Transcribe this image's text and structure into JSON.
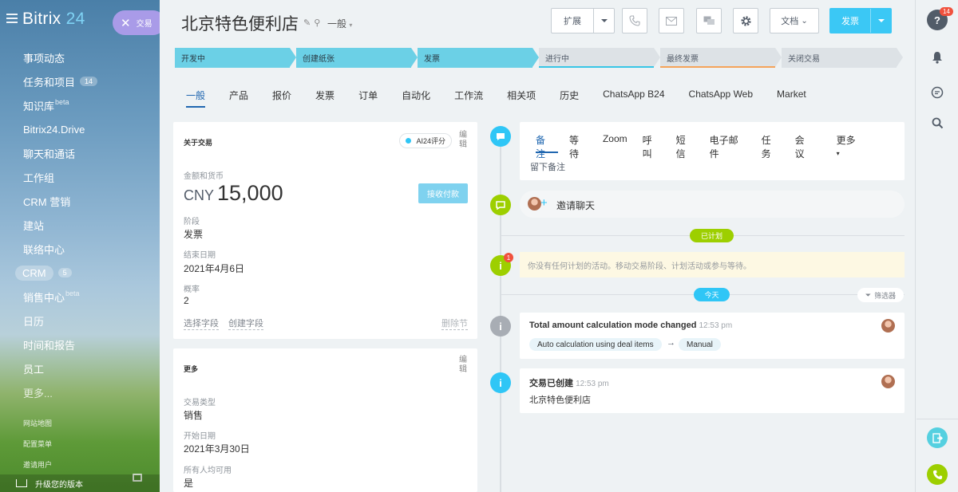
{
  "sidebar": {
    "logo_main": "Bitrix",
    "logo_num": "24",
    "deal_pill": "交易",
    "items": [
      {
        "label": "事项动态",
        "sup": "",
        "badge": ""
      },
      {
        "label": "任务和项目",
        "sup": "",
        "badge": "14"
      },
      {
        "label": "知识库",
        "sup": "beta",
        "badge": ""
      },
      {
        "label": "Bitrix24.Drive",
        "sup": "",
        "badge": ""
      },
      {
        "label": "聊天和通话",
        "sup": "",
        "badge": ""
      },
      {
        "label": "工作组",
        "sup": "",
        "badge": ""
      },
      {
        "label": "CRM 营销",
        "sup": "",
        "badge": ""
      },
      {
        "label": "建站",
        "sup": "",
        "badge": ""
      },
      {
        "label": "联络中心",
        "sup": "",
        "badge": ""
      },
      {
        "label": "CRM",
        "sup": "",
        "badge": "5"
      },
      {
        "label": "销售中心",
        "sup": "beta",
        "badge": ""
      },
      {
        "label": "日历",
        "sup": "",
        "badge": ""
      },
      {
        "label": "时间和报告",
        "sup": "",
        "badge": ""
      },
      {
        "label": "员工",
        "sup": "",
        "badge": ""
      },
      {
        "label": "更多...",
        "sup": "",
        "badge": ""
      }
    ],
    "sitemap": "网站地图",
    "config_menu": "配置菜单",
    "invite": "邀请用户",
    "upgrade": "升级您的版本"
  },
  "header": {
    "title": "北京特色便利店",
    "category": "一般",
    "expand_label": "扩展",
    "docs_label": "文档",
    "invoice_label": "发票"
  },
  "stages": [
    {
      "label": "开发中",
      "state": "done"
    },
    {
      "label": "创建纸张",
      "state": "done"
    },
    {
      "label": "发票",
      "state": "done"
    },
    {
      "label": "进行中",
      "state": "todo"
    },
    {
      "label": "最终发票",
      "state": "todo"
    },
    {
      "label": "关闭交易",
      "state": "todo"
    }
  ],
  "tabs": [
    "一般",
    "产品",
    "报价",
    "发票",
    "订单",
    "自动化",
    "工作流",
    "相关项",
    "历史",
    "ChatsApp B24",
    "ChatsApp Web",
    "Market"
  ],
  "about": {
    "heading": "关于交易",
    "ai_label": "AI24评分",
    "edit_label": "编辑",
    "amount_label": "金额和货币",
    "currency": "CNY",
    "amount": "15,000",
    "pay_label": "接收付款",
    "stage_label": "阶段",
    "stage_value": "发票",
    "close_label": "结束日期",
    "close_value": "2021年4月6日",
    "prob_label": "概率",
    "prob_value": "2",
    "select_field": "选择字段",
    "create_field": "创建字段",
    "delete_section": "删除节"
  },
  "more": {
    "heading": "更多",
    "edit_label": "编辑",
    "type_label": "交易类型",
    "type_value": "销售",
    "start_label": "开始日期",
    "start_value": "2021年3月30日",
    "avail_label": "所有人均可用",
    "avail_value": "是"
  },
  "timeline": {
    "tabs": [
      "备注",
      "等待",
      "Zoom",
      "呼叫",
      "短信",
      "电子邮件",
      "任务",
      "会议",
      "更多"
    ],
    "note_placeholder": "留下备注",
    "invite_chat": "邀请聊天",
    "planned_label": "已计划",
    "empty_text": "你没有任何计划的活动。移动交易阶段、计划活动或参与等待。",
    "empty_badge": "1",
    "today_label": "今天",
    "filter_label": "筛选器",
    "event1": {
      "title": "Total amount calculation mode changed",
      "time": "12:53 pm",
      "from": "Auto calculation using deal items",
      "arrow": "→",
      "to": "Manual"
    },
    "event2": {
      "title": "交易已创建",
      "time": "12:53 pm",
      "body": "北京特色便利店"
    }
  },
  "rightbar": {
    "help_badge": "14"
  },
  "colors": {
    "accent": "#3bc8f5",
    "stage_done": "#6bd0e6",
    "tab_active": "#2067b0",
    "timeline_green": "#9dcf00",
    "timeline_blue": "#2fc6f6"
  }
}
